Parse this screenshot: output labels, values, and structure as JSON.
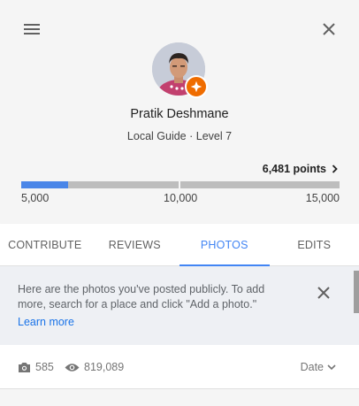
{
  "profile": {
    "name": "Pratik Deshmane",
    "level_text": "Local Guide · Level 7",
    "points_text": "6,481 points",
    "progress": {
      "min_label": "5,000",
      "mid_label": "10,000",
      "max_label": "15,000",
      "min": 5000,
      "max": 15000,
      "value": 6481
    }
  },
  "tabs": [
    {
      "label": "CONTRIBUTE",
      "active": false
    },
    {
      "label": "REVIEWS",
      "active": false
    },
    {
      "label": "PHOTOS",
      "active": true
    },
    {
      "label": "EDITS",
      "active": false
    }
  ],
  "info": {
    "message": "Here are the photos you've posted publicly. To add more, search for a place and click \"Add a photo.\"",
    "link": "Learn more"
  },
  "stats": {
    "photo_count": "585",
    "view_count": "819,089",
    "sort_label": "Date"
  },
  "colors": {
    "accent": "#4285f4",
    "progress_fill": "#4a86e8",
    "badge": "#ef6c00",
    "link": "#1a73e8"
  },
  "icons": [
    "menu-icon",
    "close-icon",
    "star-badge-icon",
    "chevron-right-icon",
    "camera-icon",
    "eye-icon",
    "chevron-down-icon"
  ]
}
